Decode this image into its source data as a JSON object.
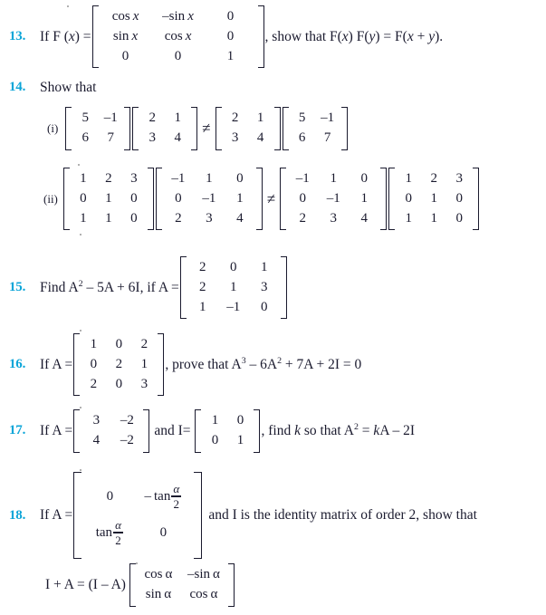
{
  "page": {
    "background_color": "#ffffff",
    "number_color": "#0ca5d8",
    "text_color": "#1a1a2e"
  },
  "problems": [
    {
      "number": "13.",
      "lead": "If F (x) =",
      "trail": ", show that F(x) F(y) = F(x + y).",
      "matrix": {
        "rows": [
          [
            "cos x",
            "–sin x",
            "0"
          ],
          [
            "sin x",
            "cos x",
            "0"
          ],
          [
            "0",
            "0",
            "1"
          ]
        ]
      }
    },
    {
      "number": "14.",
      "lead": "Show that",
      "parts": [
        {
          "label": "(i)",
          "left": [
            {
              "rows": [
                [
                  "5",
                  "–1"
                ],
                [
                  "6",
                  "7"
                ]
              ]
            },
            {
              "rows": [
                [
                  "2",
                  "1"
                ],
                [
                  "3",
                  "4"
                ]
              ]
            }
          ],
          "relation": "≠",
          "right": [
            {
              "rows": [
                [
                  "2",
                  "1"
                ],
                [
                  "3",
                  "4"
                ]
              ]
            },
            {
              "rows": [
                [
                  "5",
                  "–1"
                ],
                [
                  "6",
                  "7"
                ]
              ]
            }
          ]
        },
        {
          "label": "(ii)",
          "left": [
            {
              "rows": [
                [
                  "1",
                  "2",
                  "3"
                ],
                [
                  "0",
                  "1",
                  "0"
                ],
                [
                  "1",
                  "1",
                  "0"
                ]
              ]
            },
            {
              "rows": [
                [
                  "–1",
                  "1",
                  "0"
                ],
                [
                  "0",
                  "–1",
                  "1"
                ],
                [
                  "2",
                  "3",
                  "4"
                ]
              ]
            }
          ],
          "relation": "≠",
          "right": [
            {
              "rows": [
                [
                  "–1",
                  "1",
                  "0"
                ],
                [
                  "0",
                  "–1",
                  "1"
                ],
                [
                  "2",
                  "3",
                  "4"
                ]
              ]
            },
            {
              "rows": [
                [
                  "1",
                  "2",
                  "3"
                ],
                [
                  "0",
                  "1",
                  "0"
                ],
                [
                  "1",
                  "1",
                  "0"
                ]
              ]
            }
          ]
        }
      ]
    },
    {
      "number": "15.",
      "lead": "Find A² – 5A + 6I, if A =",
      "matrix": {
        "rows": [
          [
            "2",
            "0",
            "1"
          ],
          [
            "2",
            "1",
            "3"
          ],
          [
            "1",
            "–1",
            "0"
          ]
        ]
      }
    },
    {
      "number": "16.",
      "lead": "If A =",
      "trail": ", prove that A³ – 6A² + 7A + 2I = 0",
      "matrix": {
        "rows": [
          [
            "1",
            "0",
            "2"
          ],
          [
            "0",
            "2",
            "1"
          ],
          [
            "2",
            "0",
            "3"
          ]
        ]
      }
    },
    {
      "number": "17.",
      "lead": "If A =",
      "middle": "and I=",
      "trail": ", find k so that A² = kA – 2I",
      "matrix_a": {
        "rows": [
          [
            "3",
            "–2"
          ],
          [
            "4",
            "–2"
          ]
        ]
      },
      "matrix_i": {
        "rows": [
          [
            "1",
            "0"
          ],
          [
            "0",
            "1"
          ]
        ]
      }
    },
    {
      "number": "18.",
      "lead": "If A =",
      "trail": "and I is the identity matrix of order 2, show that",
      "matrix": {
        "rows": [
          [
            "0",
            "– tan α/2"
          ],
          [
            "tan α/2",
            "0"
          ]
        ]
      },
      "conclusion_lead": "I + A = (I – A)",
      "conclusion_matrix": {
        "rows": [
          [
            "cos α",
            "–sin α"
          ],
          [
            "sin α",
            "cos α"
          ]
        ]
      }
    }
  ]
}
